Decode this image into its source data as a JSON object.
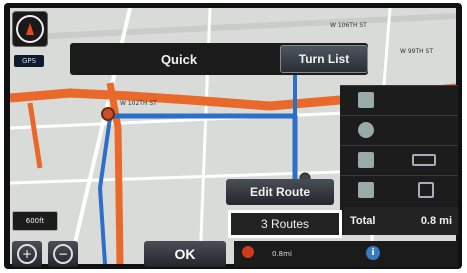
{
  "header": {
    "quick_label": "Quick",
    "turn_list_label": "Turn List"
  },
  "compass": {
    "label": "GPS"
  },
  "map": {
    "street_labels": [
      "W 106TH ST",
      "W 102TH ST",
      "W 99TH ST"
    ],
    "scale_label": "600ft"
  },
  "route_panel": {
    "edit_route_label": "Edit Route",
    "routes_label": "3 Routes",
    "total_label": "Total",
    "total_value": "0.8 mi"
  },
  "bottom_bar": {
    "ok_label": "OK",
    "zoom_in_symbol": "+",
    "zoom_out_symbol": "−",
    "distance_text": "0.8mi",
    "info_symbol": "i"
  },
  "colors": {
    "route_orange": "#e8692a",
    "route_blue": "#2a6fc9",
    "panel_dark": "#1b1b1b",
    "map_bg": "#d9dbd8"
  },
  "icons": [
    "compass-icon",
    "destination-flag-icon",
    "info-icon",
    "zoom-in-icon",
    "zoom-out-icon",
    "road-icon",
    "car-icon",
    "fuel-icon"
  ]
}
